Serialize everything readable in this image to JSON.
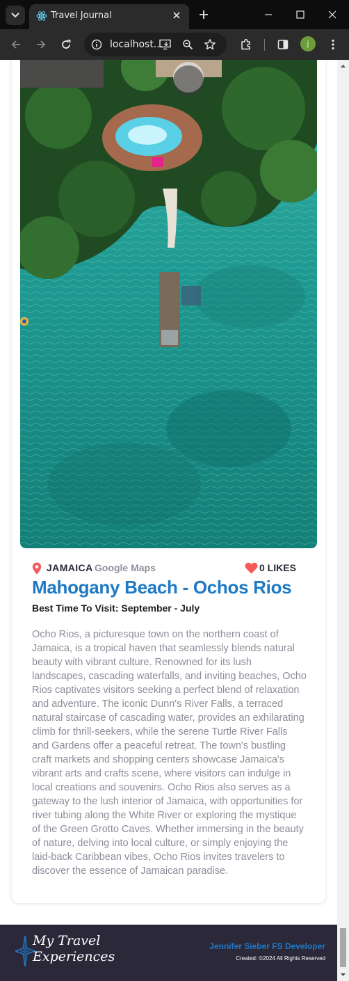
{
  "browser": {
    "tab_title": "Travel Journal",
    "url": "localhost...",
    "profile_initial": "j"
  },
  "entry": {
    "country": "JAMAICA",
    "maps_link": "Google Maps",
    "likes": "0 LIKES",
    "title": "Mahogany Beach - Ochos Rios",
    "best_time": "Best Time To Visit: September - July",
    "description": "Ocho Rios, a picturesque town on the northern coast of Jamaica, is a tropical haven that seamlessly blends natural beauty with vibrant culture. Renowned for its lush landscapes, cascading waterfalls, and inviting beaches, Ocho Rios captivates visitors seeking a perfect blend of relaxation and adventure. The iconic Dunn's River Falls, a terraced natural staircase of cascading water, provides an exhilarating climb for thrill-seekers, while the serene Turtle River Falls and Gardens offer a peaceful retreat. The town's bustling craft markets and shopping centers showcase Jamaica's vibrant arts and crafts scene, where visitors can indulge in local creations and souvenirs. Ocho Rios also serves as a gateway to the lush interior of Jamaica, with opportunities for river tubing along the White River or exploring the mystique of the Green Grotto Caves. Whether immersing in the beauty of nature, delving into local culture, or simply enjoying the laid-back Caribbean vibes, Ocho Rios invites travelers to discover the essence of Jamaican paradise."
  },
  "footer": {
    "logo_line1": "My Travel",
    "logo_line2": "Experiences",
    "developer": "Jennifer Sieber FS Developer",
    "copyright": "Created: ©2024 All Rights Reserved"
  },
  "colors": {
    "accent_blue": "#1e7ac4",
    "heart_red": "#f55a5a",
    "footer_bg": "#2b283a"
  },
  "icons": [
    "tab-list-icon",
    "react-favicon-icon",
    "close-icon",
    "plus-icon",
    "minimize-icon",
    "maximize-icon",
    "window-close-icon",
    "back-icon",
    "forward-icon",
    "reload-icon",
    "site-info-icon",
    "install-icon",
    "zoom-icon",
    "bookmark-star-icon",
    "extensions-icon",
    "side-panel-icon",
    "menu-icon",
    "location-pin-icon",
    "heart-icon",
    "star-logo-icon"
  ]
}
